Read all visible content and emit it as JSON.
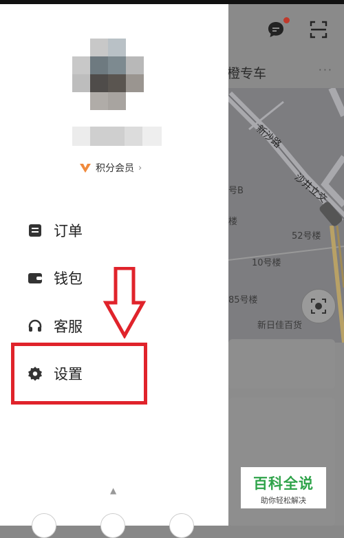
{
  "drawer": {
    "member_label": "积分会员",
    "member_chevron": "›",
    "menu": [
      {
        "label": "订单",
        "icon": "order-icon"
      },
      {
        "label": "钱包",
        "icon": "wallet-icon"
      },
      {
        "label": "客服",
        "icon": "headset-icon"
      },
      {
        "label": "设置",
        "icon": "gear-icon"
      }
    ],
    "up_caret": "▲"
  },
  "map": {
    "tab_label": "橙专车",
    "more": "···",
    "roads": [
      "新沙路",
      "沙井立交"
    ],
    "places": [
      "号B",
      "楼",
      "52号楼",
      "10号楼",
      "85号楼",
      "新日佳百货"
    ]
  },
  "watermark": {
    "title": "百科全说",
    "subtitle": "助你轻松解决"
  },
  "colors": {
    "highlight": "#e0232b",
    "watermark_green": "#2fa34a",
    "member_badge": "#f08a3c"
  }
}
